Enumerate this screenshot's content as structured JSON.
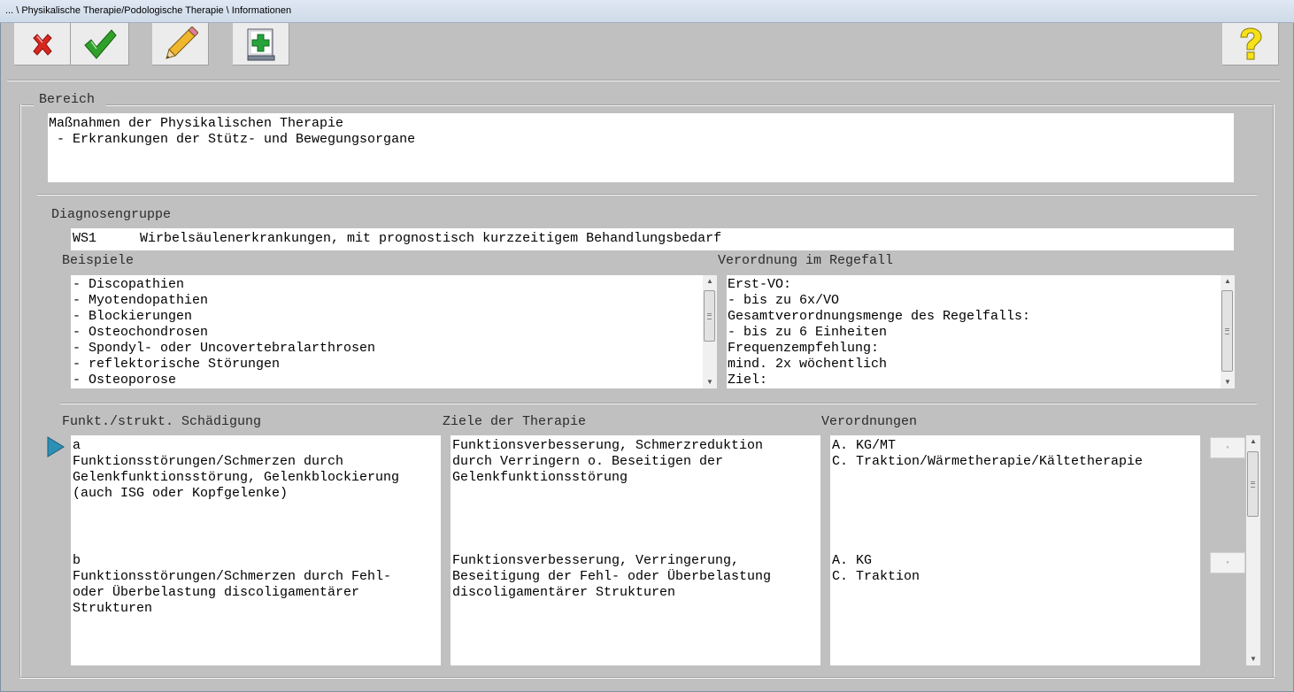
{
  "window": {
    "title": "... \\ Physikalische Therapie/Podologische Therapie \\ Informationen"
  },
  "toolbar": {
    "cancel": {
      "icon": "red-x-icon"
    },
    "confirm": {
      "icon": "green-check-icon"
    },
    "edit": {
      "icon": "pencil-icon"
    },
    "add": {
      "icon": "green-plus-book-icon"
    },
    "help": {
      "icon": "yellow-question-icon"
    }
  },
  "bereich": {
    "label": "Bereich",
    "line1": "Maßnahmen der Physikalischen Therapie",
    "line2": " - Erkrankungen der Stütz- und Bewegungsorgane"
  },
  "diagnosengruppe": {
    "label": "Diagnosengruppe",
    "code": "WS1",
    "text": "Wirbelsäulenerkrankungen, mit prognostisch kurzzeitigem Behandlungsbedarf"
  },
  "beispiele": {
    "label": "Beispiele",
    "items": [
      "- Discopathien",
      "- Myotendopathien",
      "- Blockierungen",
      "- Osteochondrosen",
      "- Spondyl- oder Uncovertebralarthrosen",
      "- reflektorische Störungen",
      "- Osteoporose"
    ]
  },
  "verordnung_regelfall": {
    "label": "Verordnung im Regefall",
    "items": [
      "Erst-VO:",
      "- bis zu 6x/VO",
      "Gesamtverordnungsmenge des Regelfalls:",
      "- bis zu 6 Einheiten",
      "Frequenzempfehlung:",
      "mind. 2x wöchentlich",
      "Ziel:"
    ]
  },
  "table": {
    "headers": {
      "schaedigung": "Funkt./strukt. Schädigung",
      "ziele": "Ziele der Therapie",
      "verordnungen": "Verordnungen"
    },
    "rows": [
      {
        "schaedigung": [
          "a",
          "Funktionsstörungen/Schmerzen durch",
          "Gelenkfunktionsstörung, Gelenkblockierung",
          "(auch ISG oder Kopfgelenke)"
        ],
        "ziele": [
          "Funktionsverbesserung, Schmerzreduktion",
          "durch Verringern o. Beseitigen der",
          "Gelenkfunktionsstörung"
        ],
        "verordnungen": [
          "A. KG/MT",
          "C. Traktion/Wärmetherapie/Kältetherapie"
        ]
      },
      {
        "schaedigung": [
          "b",
          "Funktionsstörungen/Schmerzen durch Fehl-",
          "oder Überbelastung discoligamentärer",
          "Strukturen"
        ],
        "ziele": [
          "Funktionsverbesserung, Verringerung,",
          "Beseitigung der Fehl- oder Überbelastung",
          "discoligamentärer Strukturen"
        ],
        "verordnungen": [
          "A. KG",
          "C. Traktion"
        ]
      }
    ]
  }
}
